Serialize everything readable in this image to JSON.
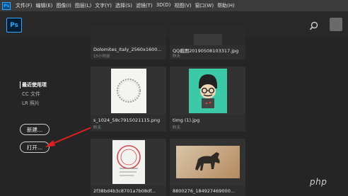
{
  "menubar": {
    "app_badge": "Ps",
    "items": [
      "文件(F)",
      "编辑(E)",
      "图像(I)",
      "图层(L)",
      "文字(Y)",
      "选择(S)",
      "滤镜(T)",
      "3D(D)",
      "视图(V)",
      "窗口(W)",
      "帮助(H)"
    ]
  },
  "header": {
    "logo": "Ps",
    "search_icon": "search-icon"
  },
  "sidebar": {
    "items": [
      "最近使用项",
      "CC 文件",
      "LR 照片"
    ],
    "new_button": "新建...",
    "open_button": "打开..."
  },
  "files": [
    {
      "name": "Dolomites_Italy_2560x1600...",
      "time": "15小时前"
    },
    {
      "name": "QQ截图20190508103317.jpg",
      "time": "昨天"
    },
    {
      "name": "s_1024_58c7915021115.png",
      "time": "昨天"
    },
    {
      "name": "timg (1).jpg",
      "time": "昨天"
    },
    {
      "name": "2f38bd4b3c8701a7b08df...",
      "time": ""
    },
    {
      "name": "8800276_184927469000...",
      "time": ""
    }
  ],
  "watermark": "php",
  "colors": {
    "accent": "#31a8ff",
    "arrow": "#e02020",
    "background": "#252525"
  }
}
